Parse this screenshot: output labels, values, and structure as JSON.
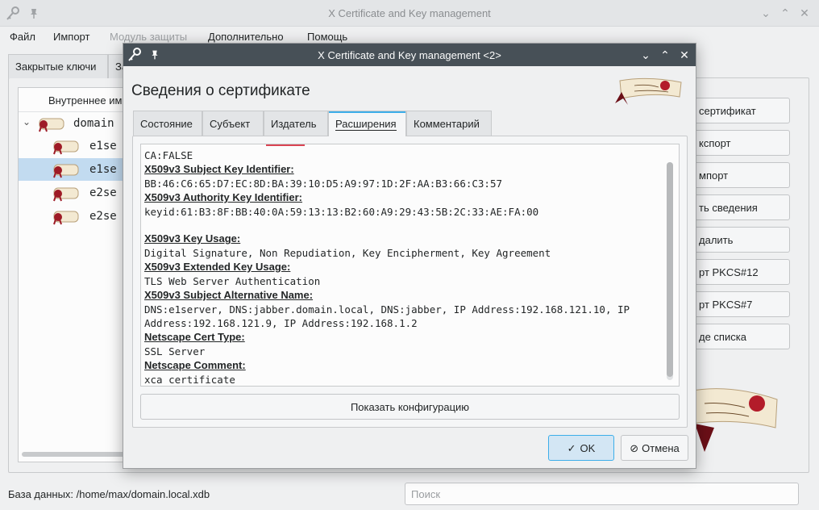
{
  "main_window": {
    "title": "X Certificate and Key management",
    "menu": [
      {
        "label": "Файл",
        "disabled": false
      },
      {
        "label": "Импорт",
        "disabled": false
      },
      {
        "label": "Модуль защиты",
        "disabled": true
      },
      {
        "label": "Дополнительно",
        "disabled": false
      },
      {
        "label": "Помощь",
        "disabled": false
      }
    ],
    "tabs": [
      "Закрытые ключи",
      "За"
    ],
    "tree": {
      "header": "Внутреннее им",
      "root": "domain",
      "items": [
        "e1se",
        "e1se",
        "e2se",
        "e2se"
      ]
    },
    "right_buttons": [
      "сертификат",
      "кспорт",
      "мпорт",
      "ть сведения",
      "далить",
      "рт PKCS#12",
      "рт PKCS#7",
      "де списка"
    ],
    "status_label": "База данных: /home/max/domain.local.xdb",
    "search_placeholder": "Поиск"
  },
  "dialog": {
    "title": "X Certificate and Key management <2>",
    "heading": "Сведения о сертификате",
    "tabs": [
      "Состояние",
      "Субъект",
      "Издатель",
      "Расширения",
      "Комментарий"
    ],
    "active_tab": "Расширения",
    "extensions": {
      "basic_constraints_value": "CA:FALSE",
      "ski_header": "X509v3 Subject Key Identifier:",
      "ski_value": "BB:46:C6:65:D7:EC:8D:BA:39:10:D5:A9:97:1D:2F:AA:B3:66:C3:57",
      "aki_header": "X509v3 Authority Key Identifier:",
      "aki_value": "keyid:61:B3:8F:BB:40:0A:59:13:13:B2:60:A9:29:43:5B:2C:33:AE:FA:00",
      "ku_header": "X509v3 Key Usage:",
      "ku_value": "Digital Signature, Non Repudiation, Key Encipherment, Key Agreement",
      "eku_header": "X509v3 Extended Key Usage:",
      "eku_value": "TLS Web Server Authentication",
      "san_header": "X509v3 Subject Alternative Name:",
      "san_value": "DNS:e1server, DNS:jabber.domain.local, DNS:jabber, IP Address:192.168.121.10, IP Address:192.168.121.9, IP Address:192.168.1.2",
      "nct_header": "Netscape Cert Type:",
      "nct_value": "SSL Server",
      "ncc_header": "Netscape Comment:",
      "ncc_value": "xca certificate"
    },
    "show_config_label": "Показать конфигурацию",
    "ok_label": "OK",
    "cancel_label": "Отмена"
  },
  "colors": {
    "accent": "#3daee9",
    "dialog_titlebar": "#475057",
    "selection": "#c2dbf0"
  },
  "icons": [
    "app-key-icon",
    "pin-icon",
    "minimize-icon",
    "maximize-icon",
    "close-icon",
    "certificate-icon",
    "check-icon",
    "cancel-icon",
    "expand-arrow-icon"
  ]
}
